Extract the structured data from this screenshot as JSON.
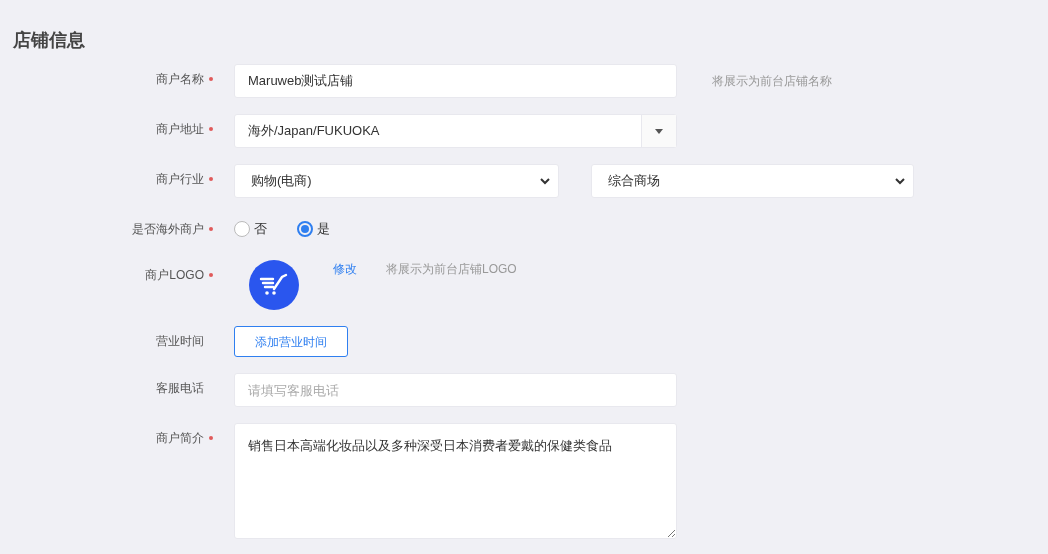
{
  "title": "店铺信息",
  "fields": [
    {
      "kind": "text",
      "label": "商户名称",
      "required": true,
      "value": "Maruweb测试店铺",
      "hint": "将展示为前台店铺名称"
    },
    {
      "kind": "cascader",
      "label": "商户地址",
      "required": true,
      "value": "海外/Japan/FUKUOKA"
    },
    {
      "kind": "selects",
      "label": "商户行业",
      "required": true,
      "selects": [
        {
          "value": "购物(电商)"
        },
        {
          "value": "综合商场"
        }
      ]
    },
    {
      "kind": "radio",
      "label": "是否海外商户",
      "required": true,
      "options": [
        {
          "label": "否",
          "selected": false
        },
        {
          "label": "是",
          "selected": true
        }
      ]
    },
    {
      "kind": "logo",
      "label": "商户LOGO",
      "required": true,
      "action": "修改",
      "hint": "将展示为前台店铺LOGO"
    },
    {
      "kind": "button",
      "label": "营业时间",
      "required": false,
      "button": "添加营业时间"
    },
    {
      "kind": "text",
      "label": "客服电话",
      "required": false,
      "placeholder": "请填写客服电话"
    },
    {
      "kind": "textarea",
      "label": "商户简介",
      "required": true,
      "value": "销售日本高端化妆品以及多种深受日本消费者爱戴的保健类食品"
    }
  ]
}
